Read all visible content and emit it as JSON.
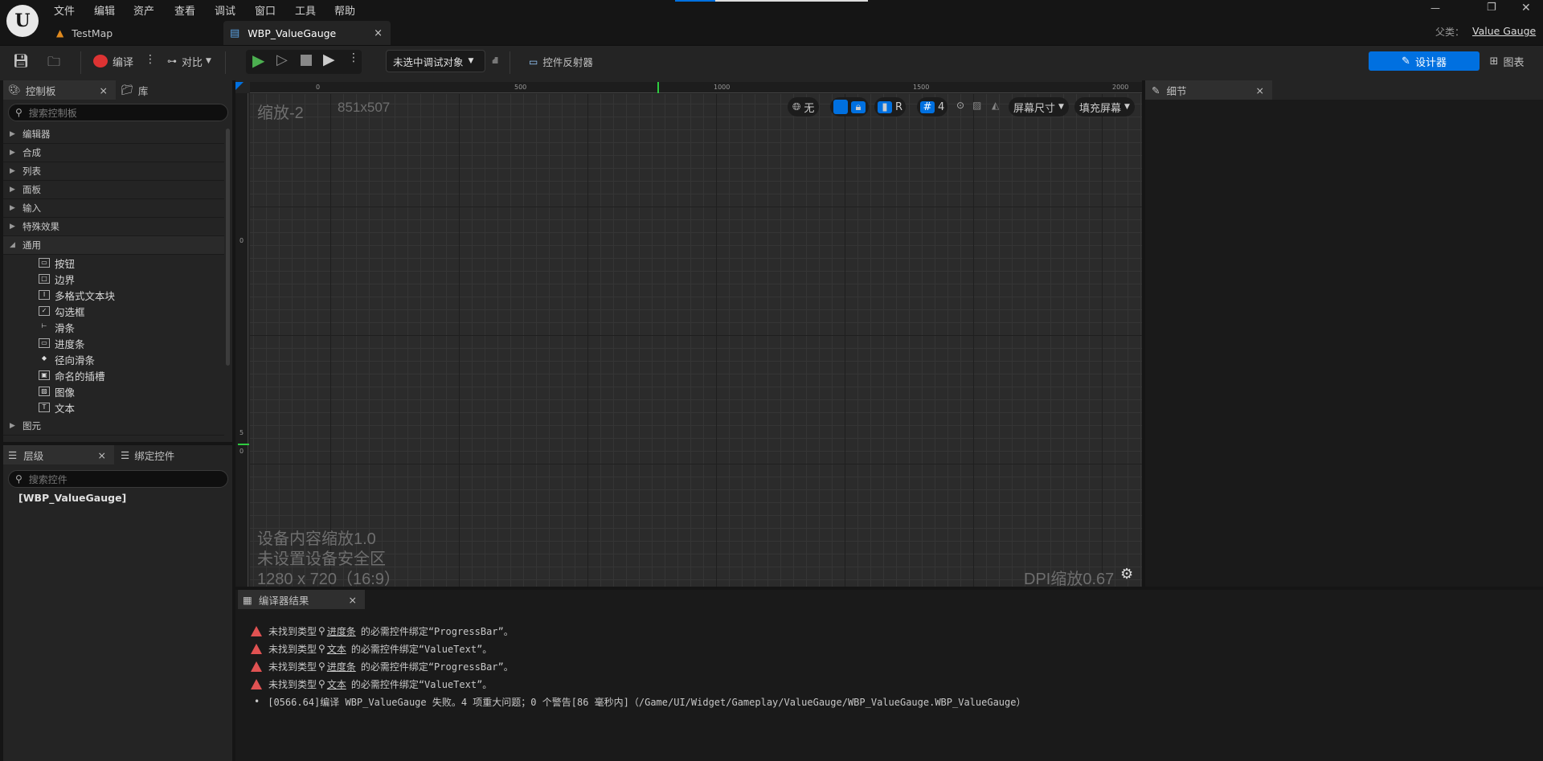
{
  "menu": [
    "文件",
    "编辑",
    "资产",
    "查看",
    "调试",
    "窗口",
    "工具",
    "帮助"
  ],
  "tabs": {
    "map": "TestMap",
    "widget": "WBP_ValueGauge",
    "close": "×"
  },
  "parent": {
    "label": "父类：",
    "value": "Value Gauge"
  },
  "window": {
    "min": "—",
    "restore": "❐",
    "close": "✕"
  },
  "toolbar": {
    "compile": "编译",
    "diff": "对比",
    "debug_target": "未选中调试对象",
    "reflector": "控件反射器",
    "designer": "设计器",
    "graph": "图表"
  },
  "palette": {
    "title": "控制板",
    "library": "库",
    "search_placeholder": "搜索控制板",
    "categories": [
      "编辑器",
      "合成",
      "列表",
      "面板",
      "输入",
      "特殊效果",
      "通用"
    ],
    "common_items": [
      {
        "label": "按钮",
        "icon": "▭"
      },
      {
        "label": "边界",
        "icon": "□"
      },
      {
        "label": "多格式文本块",
        "icon": "Ⅰ"
      },
      {
        "label": "勾选框",
        "icon": "✓"
      },
      {
        "label": "滑条",
        "icon": "⊢"
      },
      {
        "label": "进度条",
        "icon": "▭"
      },
      {
        "label": "径向滑条",
        "icon": "◆"
      },
      {
        "label": "命名的插槽",
        "icon": "▣"
      },
      {
        "label": "图像",
        "icon": "▨"
      },
      {
        "label": "文本",
        "icon": "T"
      }
    ],
    "last_category": "图元"
  },
  "hierarchy": {
    "title": "层级",
    "bind": "绑定控件",
    "search_placeholder": "搜索控件",
    "root": "[WBP_ValueGauge]"
  },
  "details": {
    "title": "细节"
  },
  "ruler": {
    "ticks": [
      "0",
      "500",
      "1000",
      "1500",
      "2000"
    ],
    "vticks": [
      "0",
      "5",
      "0"
    ]
  },
  "canvas": {
    "zoom": "缩放-2",
    "size": "851x507",
    "overlay": [
      "设备内容缩放1.0",
      "未设置设备安全区",
      "1280 x 720（16:9）"
    ],
    "dpi": "DPI缩放0.67",
    "controls": {
      "none": "无",
      "r": "R",
      "grid": "4",
      "screen_size": "屏幕尺寸",
      "fill": "填充屏幕"
    }
  },
  "compiler": {
    "title": "编译器结果",
    "messages": [
      {
        "pre": "未找到类型",
        "link": "进度条",
        "post": "的必需控件绑定“ProgressBar”。"
      },
      {
        "pre": "未找到类型",
        "link": "文本",
        "post": "的必需控件绑定“ValueText”。"
      },
      {
        "pre": "未找到类型",
        "link": "进度条",
        "post": "的必需控件绑定“ProgressBar”。"
      },
      {
        "pre": "未找到类型",
        "link": "文本",
        "post": "的必需控件绑定“ValueText”。"
      }
    ],
    "summary": "[0566.64]编译 WBP_ValueGauge 失败。4 项重大问题；0 个警告[86 毫秒内]（/Game/UI/Widget/Gameplay/ValueGauge/WBP_ValueGauge.WBP_ValueGauge）"
  },
  "colors": {
    "accent": "#0070e0",
    "error": "#e05252",
    "play": "#4caf50"
  }
}
